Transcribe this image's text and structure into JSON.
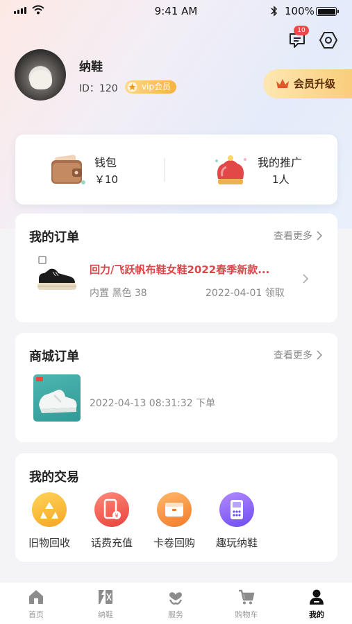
{
  "status_bar": {
    "time": "9:41 AM",
    "battery": "100%"
  },
  "header": {
    "message_count": "10"
  },
  "profile": {
    "name": "纳鞋",
    "id_text": "ID：120",
    "vip_label": "vip会员",
    "upgrade_label": "会员升级"
  },
  "wallet": {
    "label": "钱包",
    "value": "￥10"
  },
  "promotion": {
    "label": "我的推广",
    "value": "1人"
  },
  "my_orders": {
    "title": "我的订单",
    "more": "查看更多",
    "product": "回力/飞跃帆布鞋女鞋2022春季新款...",
    "spec": "内置 黑色 38",
    "date": "2022-04-01 领取"
  },
  "mall_orders": {
    "title": "商城订单",
    "more": "查看更多",
    "date": "2022-04-13 08:31:32 下单"
  },
  "trades": {
    "title": "我的交易",
    "items": [
      {
        "label": "旧物回收",
        "icon": "recycle-icon"
      },
      {
        "label": "话费充值",
        "icon": "phone-recharge-icon"
      },
      {
        "label": "卡卷回购",
        "icon": "card-wallet-icon"
      },
      {
        "label": "趣玩纳鞋",
        "icon": "game-machine-icon"
      }
    ]
  },
  "tabbar": {
    "items": [
      {
        "label": "首页",
        "icon": "home-icon"
      },
      {
        "label": "纳鞋",
        "icon": "naxie-logo-icon"
      },
      {
        "label": "服务",
        "icon": "service-heart-icon"
      },
      {
        "label": "购物车",
        "icon": "cart-icon"
      },
      {
        "label": "我的",
        "icon": "user-icon",
        "active": true
      }
    ]
  },
  "colors": {
    "accent_red": "#d9474b",
    "vip_gold": "#f6b23e",
    "upgrade_gold": "#f9cd7b",
    "badge_red": "#f04848"
  }
}
